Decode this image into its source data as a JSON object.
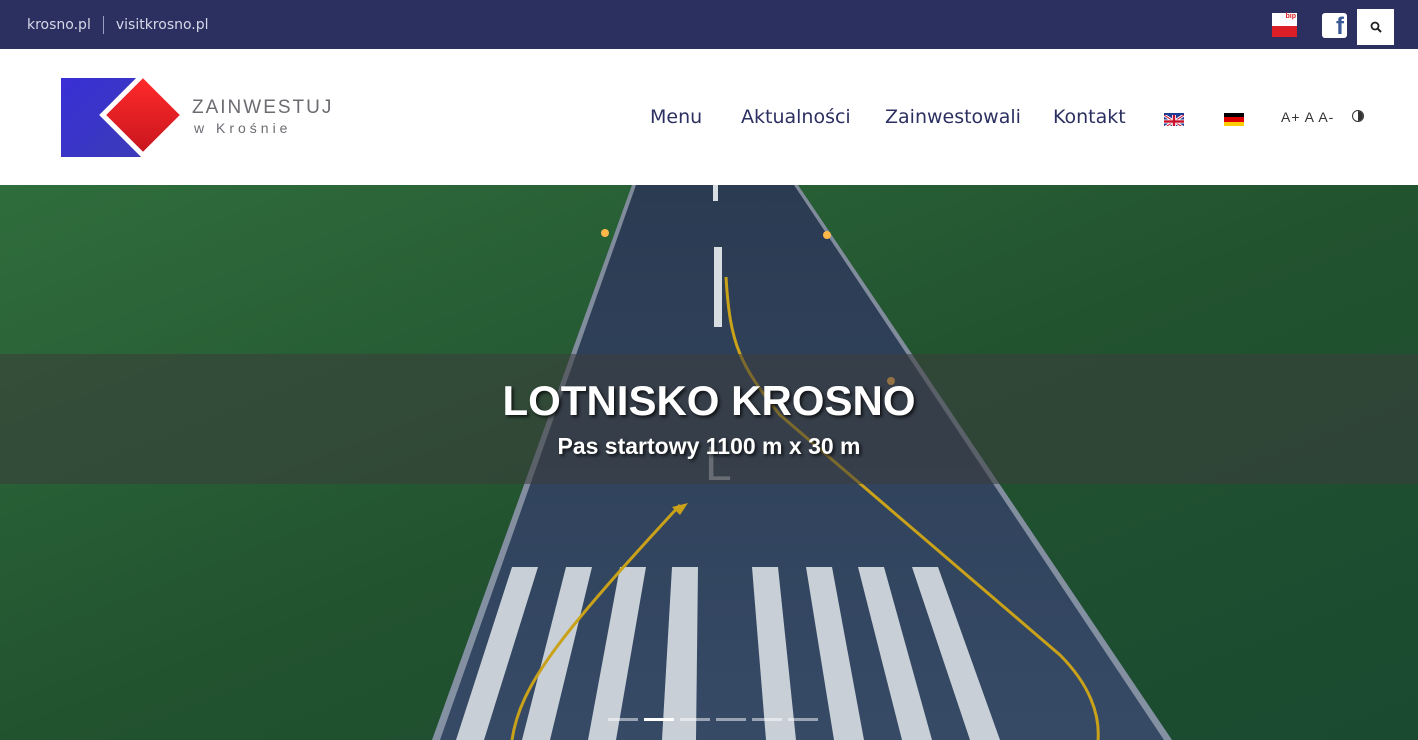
{
  "topbar": {
    "links": [
      "krosno.pl",
      "visitkrosno.pl"
    ],
    "bip_label": "bip",
    "facebook_label": "f"
  },
  "header": {
    "logo": {
      "line1": "ZAINWESTUJ",
      "line2": "w Krośnie"
    },
    "nav": [
      "Menu",
      "Aktualności",
      "Zainwestowali",
      "Kontakt"
    ],
    "font_controls": "A+ A A-"
  },
  "hero": {
    "title": "LOTNISKO KROSNO",
    "subtitle": "Pas startowy 1100 m x 30 m",
    "slides_count": 6,
    "active_slide": 2
  },
  "colors": {
    "topbar": "#2c3060",
    "nav_text": "#2c3060",
    "accent_red": "#dc1f26"
  }
}
